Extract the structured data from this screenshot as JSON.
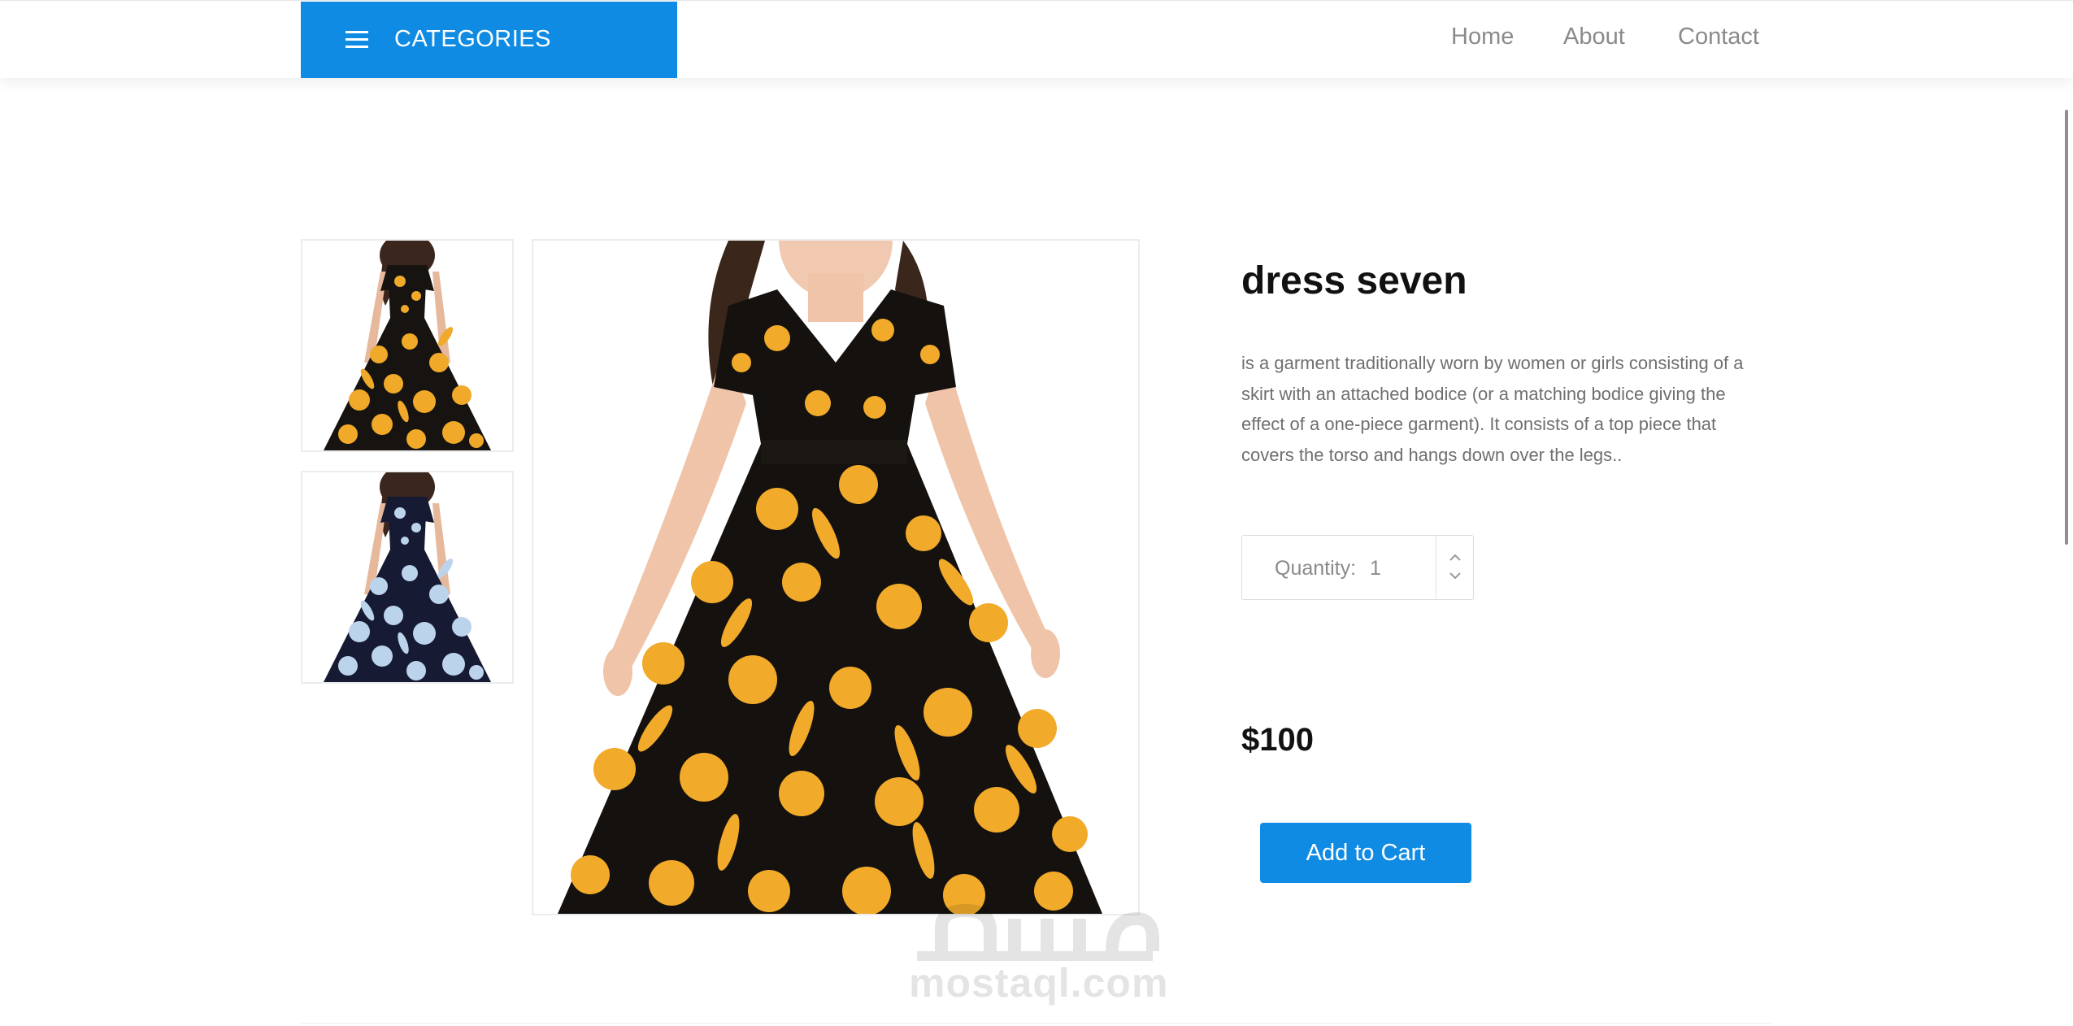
{
  "header": {
    "categories_label": "CATEGORIES",
    "nav": [
      "Home",
      "About",
      "Contact"
    ],
    "accent_color": "#0f8be4"
  },
  "gallery": {
    "thumbnails": [
      {
        "alt": "dress seven yellow floral",
        "colorway": "yellow-on-black"
      },
      {
        "alt": "dress seven blue floral",
        "colorway": "blue-on-navy"
      }
    ],
    "main_image_alt": "dress seven"
  },
  "product": {
    "title": "dress seven",
    "description": "is a garment traditionally worn by women or girls consisting of a skirt with an attached bodice (or a matching bodice giving the effect of a one-piece garment). It consists of a top piece that covers the torso and hangs down over the legs..",
    "quantity_label": "Quantity:",
    "quantity_value": "1",
    "price": "$100",
    "add_to_cart_label": "Add to Cart"
  },
  "watermark": {
    "text": "mostaql.com"
  }
}
